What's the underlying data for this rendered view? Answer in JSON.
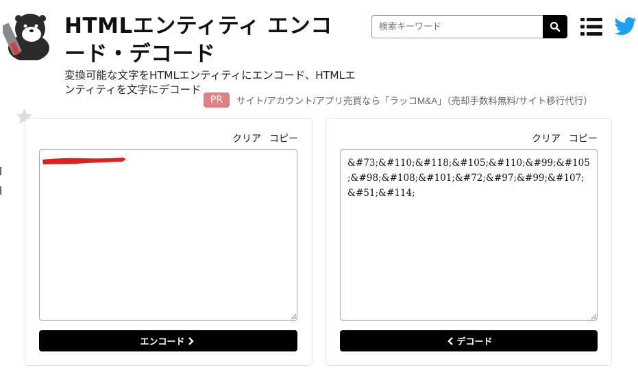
{
  "header": {
    "title": "HTMLエンティティ エンコード・デコード",
    "subtitle": "変換可能な文字をHTMLエンティティにエンコード、HTMLエンティティを文字にデコード"
  },
  "search": {
    "placeholder": "検索キーワード"
  },
  "icons": {
    "logo": "otter-mascot-logo",
    "search": "search-icon",
    "menu": "list-menu-icon",
    "twitter": "twitter-icon",
    "favorite": "star-icon"
  },
  "ad": {
    "badge": "PR",
    "text": "サイト/アカウント/アプリ売買なら「ラッコM&A」（売却手数料無料/サイト移行代行）"
  },
  "encode_panel": {
    "clear_label": "クリア",
    "copy_label": "コピー",
    "input_value": "",
    "button_label": "エンコード"
  },
  "decode_panel": {
    "clear_label": "クリア",
    "copy_label": "コピー",
    "input_value": "&#73;&#110;&#118;&#105;&#110;&#99;&#105;&#98;&#108;&#101;&#72;&#97;&#99;&#107;&#51;&#114;",
    "button_label": "デコード"
  },
  "colors": {
    "button_bg": "#000000",
    "pr_badge": "#e08080",
    "twitter": "#1da1f2",
    "redaction": "#e02020",
    "star": "#dddddd"
  }
}
